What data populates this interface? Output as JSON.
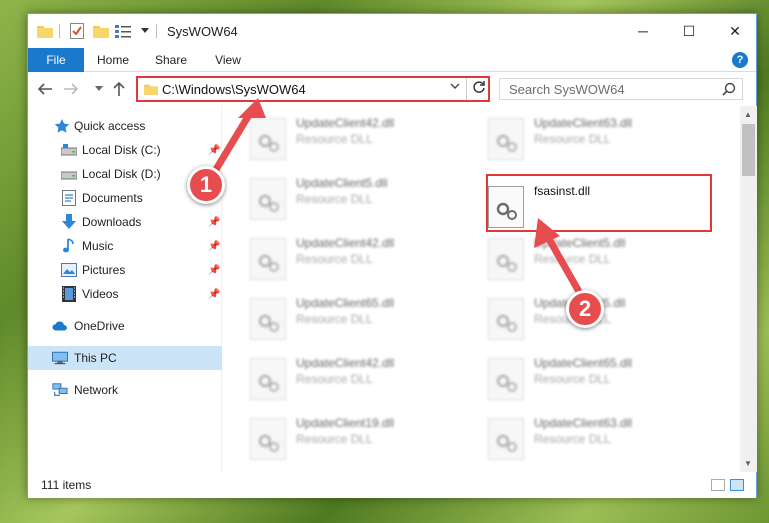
{
  "window": {
    "title": "SysWOW64",
    "minimize_label": "─",
    "maximize_label": "☐",
    "close_label": "✕"
  },
  "ribbon": {
    "tabs": [
      "File",
      "Home",
      "Share",
      "View"
    ],
    "help_label": "?"
  },
  "address": {
    "path": "C:\\Windows\\SysWOW64",
    "search_placeholder": "Search SysWOW64"
  },
  "sidebar": {
    "items": [
      {
        "label": "Quick access",
        "icon": "star-icon",
        "pinned": false
      },
      {
        "label": "Local Disk (C:)",
        "icon": "drive-icon",
        "pinned": true
      },
      {
        "label": "Local Disk (D:)",
        "icon": "drive-icon",
        "pinned": true
      },
      {
        "label": "Documents",
        "icon": "documents-icon",
        "pinned": true
      },
      {
        "label": "Downloads",
        "icon": "download-icon",
        "pinned": true
      },
      {
        "label": "Music",
        "icon": "music-icon",
        "pinned": true
      },
      {
        "label": "Pictures",
        "icon": "pictures-icon",
        "pinned": true
      },
      {
        "label": "Videos",
        "icon": "videos-icon",
        "pinned": true
      },
      {
        "label": "OneDrive",
        "icon": "cloud-icon",
        "pinned": false
      },
      {
        "label": "This PC",
        "icon": "computer-icon",
        "pinned": false,
        "selected": true
      },
      {
        "label": "Network",
        "icon": "network-icon",
        "pinned": false
      }
    ]
  },
  "files": {
    "left_column": [
      {
        "name": "UpdateClient42.dll",
        "type": "Resource DLL"
      },
      {
        "name": "UpdateClient5.dll",
        "type": "Resource DLL"
      },
      {
        "name": "UpdateClient42.dll",
        "type": "Resource DLL"
      },
      {
        "name": "UpdateClient65.dll",
        "type": "Resource DLL"
      },
      {
        "name": "UpdateClient42.dll",
        "type": "Resource DLL"
      },
      {
        "name": "UpdateClient19.dll",
        "type": "Resource DLL"
      }
    ],
    "right_column": [
      {
        "name": "UpdateClient63.dll",
        "type": "Resource DLL"
      },
      {
        "name": "fsasinst.dll",
        "type": "",
        "highlighted": true
      },
      {
        "name": "UpdateClient5.dll",
        "type": "Resource DLL"
      },
      {
        "name": "UpdateClient5.dll",
        "type": "Resource DLL"
      },
      {
        "name": "UpdateClient65.dll",
        "type": "Resource DLL"
      },
      {
        "name": "UpdateClient63.dll",
        "type": "Resource DLL"
      }
    ]
  },
  "status": {
    "item_count": "111 items"
  },
  "callouts": {
    "step1": "1",
    "step2": "2"
  },
  "colors": {
    "accent": "#1979ca",
    "highlight_red": "#e0383b",
    "selected_bg": "#cce4f7"
  }
}
